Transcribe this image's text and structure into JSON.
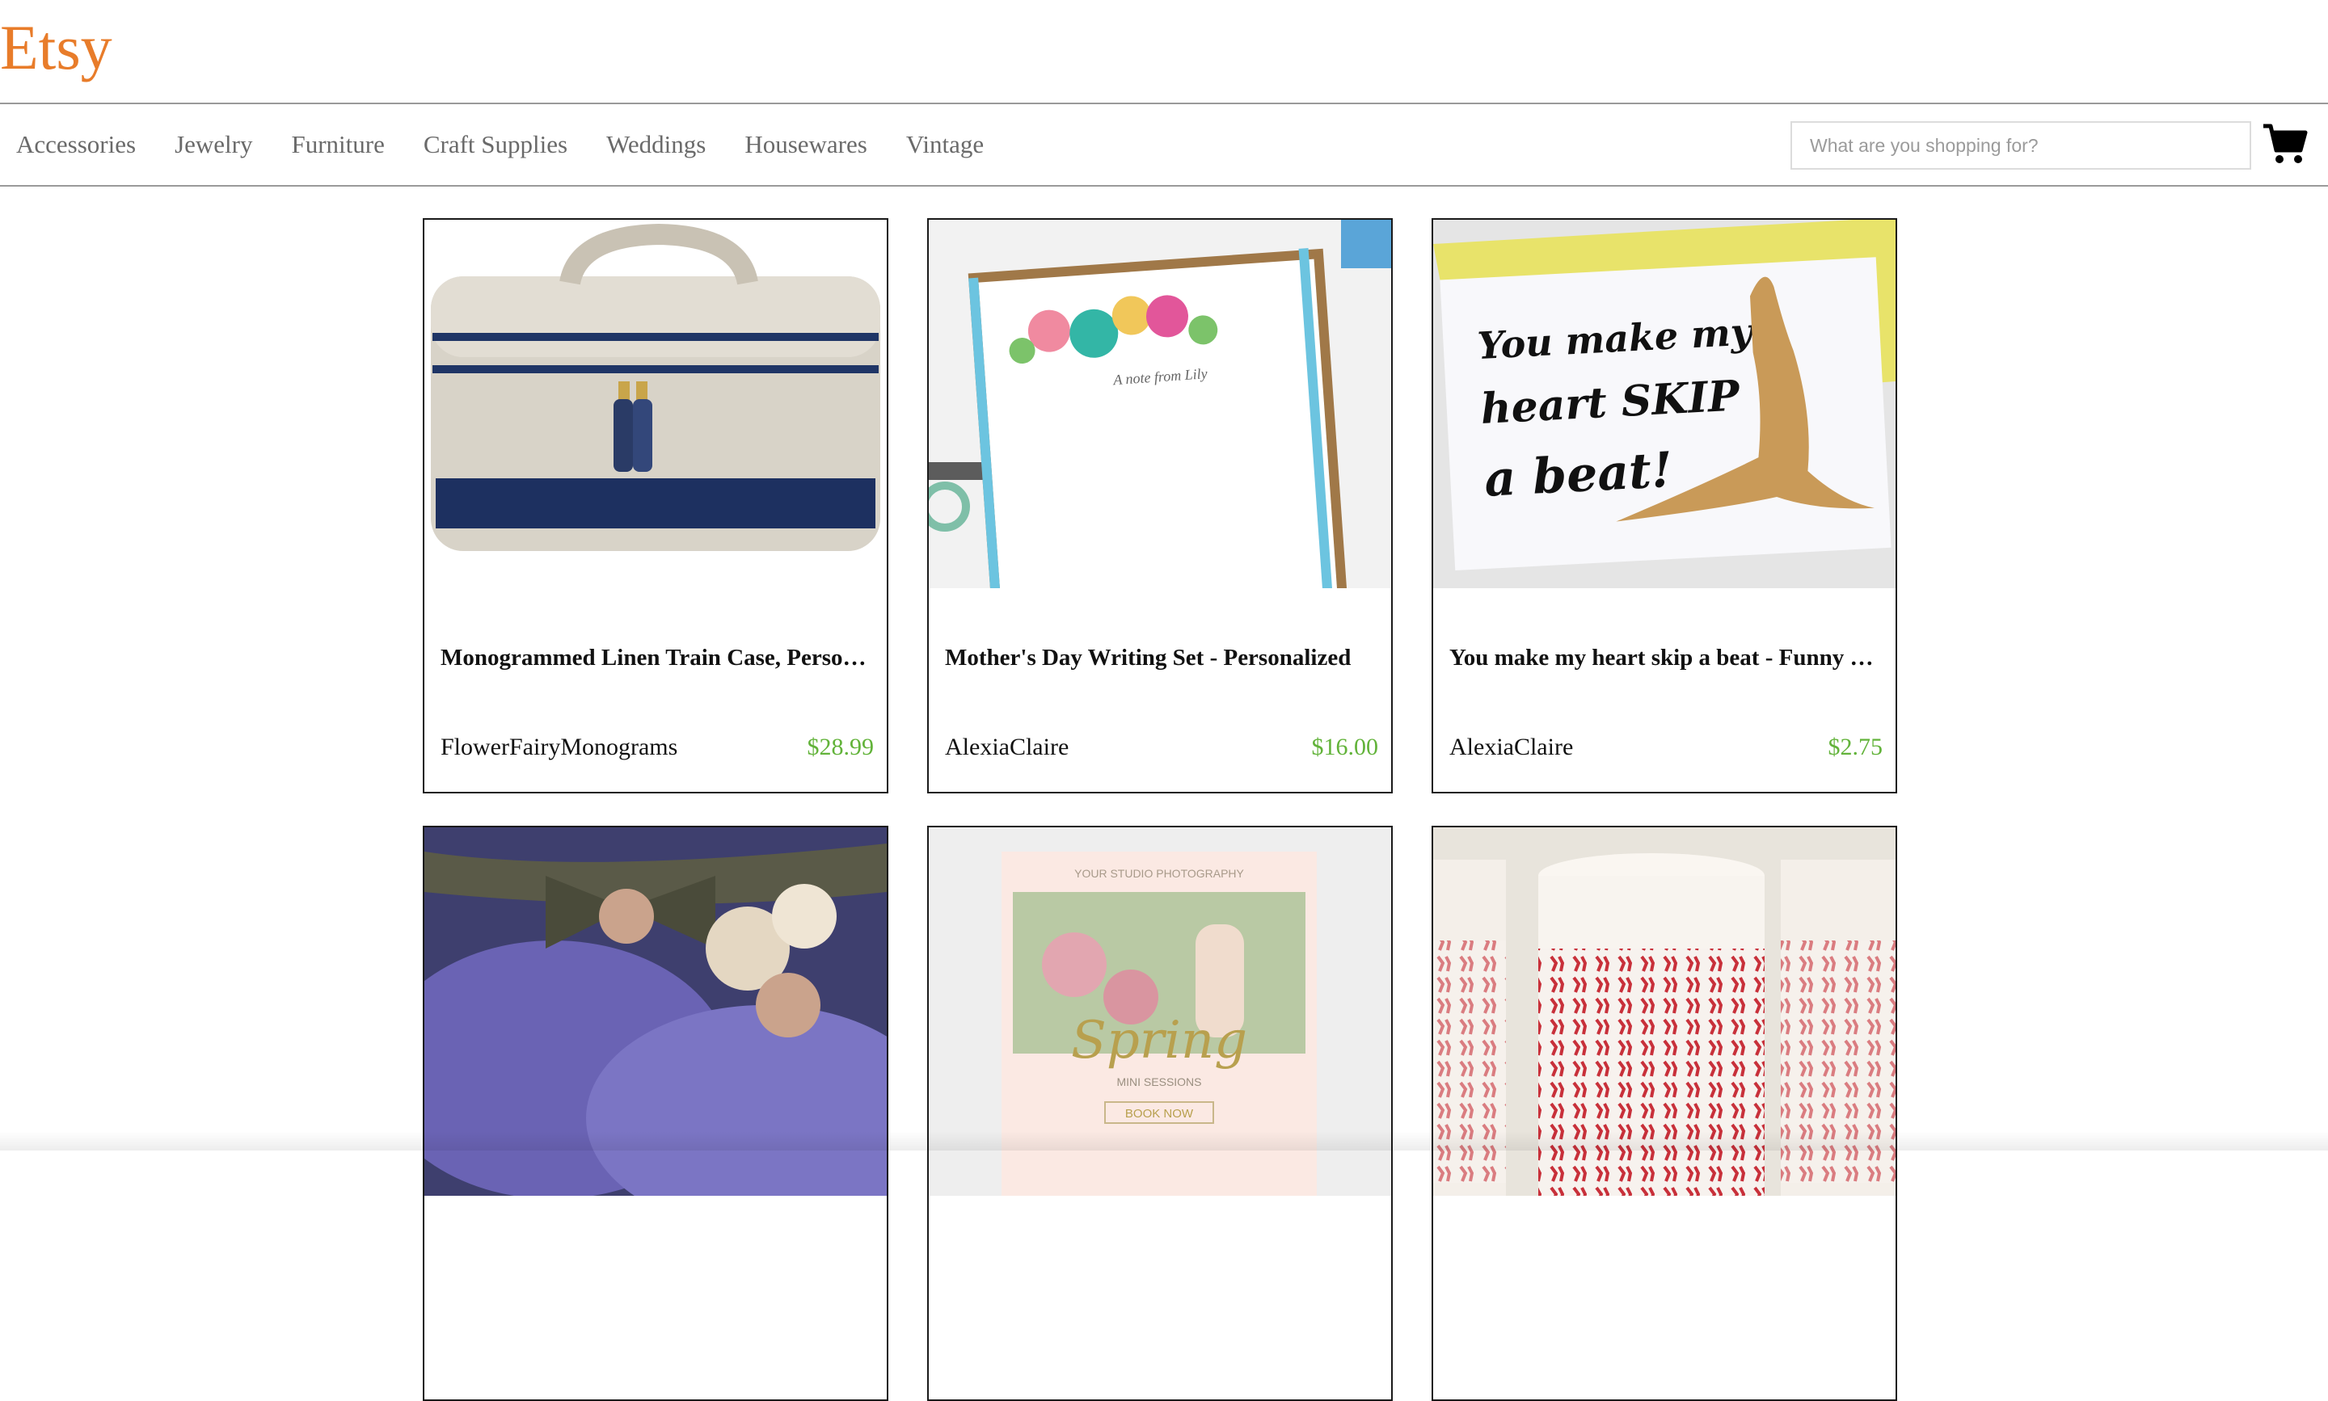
{
  "header": {
    "logo": "Etsy"
  },
  "nav": {
    "items": [
      {
        "label": "Accessories"
      },
      {
        "label": "Jewelry"
      },
      {
        "label": "Furniture"
      },
      {
        "label": "Craft Supplies"
      },
      {
        "label": "Weddings"
      },
      {
        "label": "Housewares"
      },
      {
        "label": "Vintage"
      }
    ]
  },
  "search": {
    "placeholder": "What are you shopping for?",
    "value": ""
  },
  "cart": {
    "icon": "cart-icon"
  },
  "colors": {
    "brand": "#e87c2a",
    "price": "#62b33a",
    "nav_text": "#6a6a6a"
  },
  "products": [
    {
      "title": "Monogrammed Linen Train Case, Personalized",
      "shop": "FlowerFairyMonograms",
      "price": "$28.99"
    },
    {
      "title": "Mother's Day Writing Set - Personalized",
      "shop": "AlexiaClaire",
      "price": "$16.00"
    },
    {
      "title": "You make my heart skip a beat - Funny Card",
      "shop": "AlexiaClaire",
      "price": "$2.75"
    },
    {
      "title": "",
      "shop": "",
      "price": ""
    },
    {
      "title": "",
      "shop": "",
      "price": ""
    },
    {
      "title": "",
      "shop": "",
      "price": ""
    }
  ],
  "card_images": {
    "card3_lettering": [
      "You make my",
      "heart SKIP",
      "a beat!"
    ],
    "card2_lettering": "A note from Lily",
    "card5_lettering": {
      "top": "YOUR STUDIO PHOTOGRAPHY",
      "script": "Spring",
      "sub": "MINI SESSIONS",
      "button": "BOOK NOW"
    }
  }
}
